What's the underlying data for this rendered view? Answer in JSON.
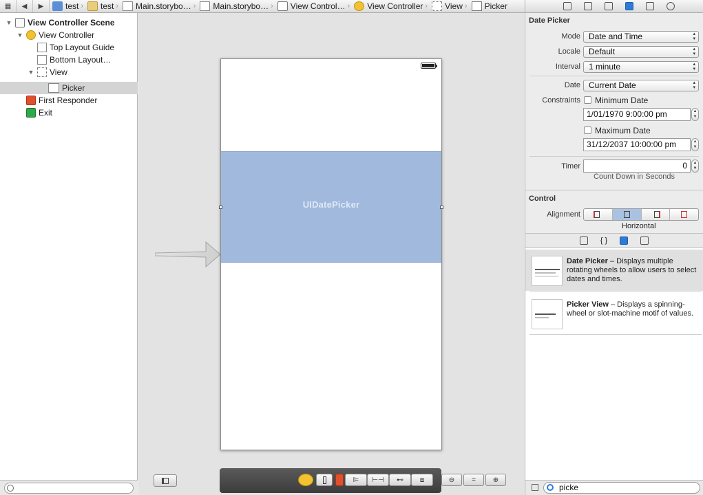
{
  "jumpbar": {
    "crumbs": [
      "test",
      "test",
      "Main.storybo…",
      "Main.storybo…",
      "View Control…",
      "View Controller",
      "View",
      "Picker"
    ]
  },
  "outline": {
    "scene": "View Controller Scene",
    "view_controller": "View Controller",
    "top_layout_guide": "Top Layout Guide",
    "bottom_layout_guide": "Bottom Layout…",
    "view": "View",
    "picker": "Picker",
    "first_responder": "First Responder",
    "exit": "Exit"
  },
  "canvas": {
    "picker_label": "UIDatePicker"
  },
  "inspector": {
    "date_picker_section": "Date Picker",
    "mode_label": "Mode",
    "mode_value": "Date and Time",
    "locale_label": "Locale",
    "locale_value": "Default",
    "interval_label": "Interval",
    "interval_value": "1 minute",
    "date_label": "Date",
    "date_value": "Current Date",
    "constraints_label": "Constraints",
    "min_date_label": "Minimum Date",
    "min_date_value": "1/01/1970   9:00:00 pm",
    "max_date_label": "Maximum Date",
    "max_date_value": "31/12/2037 10:00:00 pm",
    "timer_label": "Timer",
    "timer_value": "0",
    "timer_hint": "Count Down in Seconds",
    "control_section": "Control",
    "alignment_label": "Alignment",
    "alignment_hint": "Horizontal"
  },
  "library": {
    "items": [
      {
        "title": "Date Picker",
        "desc": " – Displays multiple rotating wheels to allow users to select dates and times."
      },
      {
        "title": "Picker View",
        "desc": " – Displays a spinning-wheel or slot-machine motif of values."
      }
    ],
    "search_value": "picke"
  },
  "colors": {
    "picker_fill": "#a1b9dc",
    "selection_blue": "#2e7bd6"
  }
}
